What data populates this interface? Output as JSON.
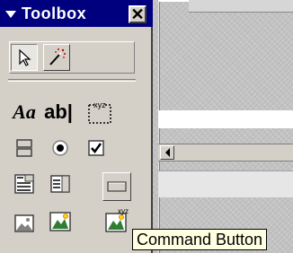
{
  "toolbox": {
    "title": "Toolbox",
    "close_glyph": "✕",
    "tools": [
      {
        "name": "select-objects",
        "icon": "pointer-arrow-icon",
        "state": "pressed"
      },
      {
        "name": "control-wizards",
        "icon": "magic-wand-icon",
        "state": "raised"
      },
      {
        "name": "label",
        "icon": "label-aa-icon",
        "text": "Aa"
      },
      {
        "name": "text-box",
        "icon": "textbox-ab-icon",
        "text": "ab|"
      },
      {
        "name": "option-group",
        "icon": "option-group-xyz-icon"
      },
      {
        "name": "toggle-button",
        "icon": "toggle-button-icon"
      },
      {
        "name": "option-button",
        "icon": "option-button-icon"
      },
      {
        "name": "check-box",
        "icon": "check-box-icon"
      },
      {
        "name": "combo-box",
        "icon": "combo-box-icon"
      },
      {
        "name": "list-box",
        "icon": "list-box-icon"
      },
      {
        "name": "command-button",
        "icon": "command-button-icon",
        "state": "hover"
      },
      {
        "name": "image",
        "icon": "image-icon"
      },
      {
        "name": "unbound-object-frame",
        "icon": "unbound-object-frame-icon"
      },
      {
        "name": "bound-object-frame",
        "icon": "bound-object-frame-icon"
      }
    ]
  },
  "tooltip": {
    "text": "Command Button"
  },
  "colors": {
    "titlebar": "#00007f",
    "face": "#d4d0c8",
    "tooltip_bg": "#ffffe1"
  }
}
